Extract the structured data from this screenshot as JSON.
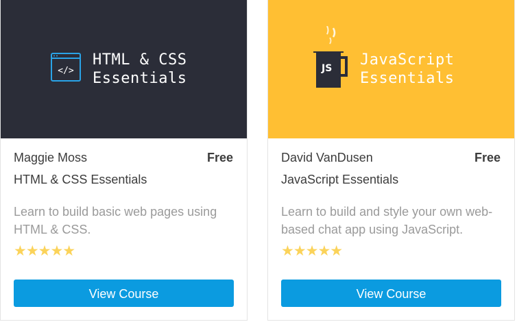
{
  "courses": [
    {
      "thumbnail_title": "HTML & CSS\nEssentials",
      "thumbnail_icon": "code-window-icon",
      "thumbnail_bg": "#2b2d38",
      "author": "Maggie Moss",
      "price": "Free",
      "name": "HTML & CSS Essentials",
      "description": "Learn to build basic web pages using HTML & CSS.",
      "rating": 5,
      "stars": "★★★★★",
      "button_label": "View Course"
    },
    {
      "thumbnail_title": "JavaScript\nEssentials",
      "thumbnail_icon": "coffee-mug-js-icon",
      "thumbnail_bg": "#ffbf33",
      "thumbnail_badge": "JS",
      "author": "David VanDusen",
      "price": "Free",
      "name": "JavaScript Essentials",
      "description": "Learn to build and style your own web-based chat app using JavaScript.",
      "rating": 5,
      "stars": "★★★★★",
      "button_label": "View Course"
    }
  ],
  "colors": {
    "accent": "#0b9be0",
    "star": "#fbd35a",
    "text": "#3c3c3c",
    "muted": "#9a9a9a"
  }
}
